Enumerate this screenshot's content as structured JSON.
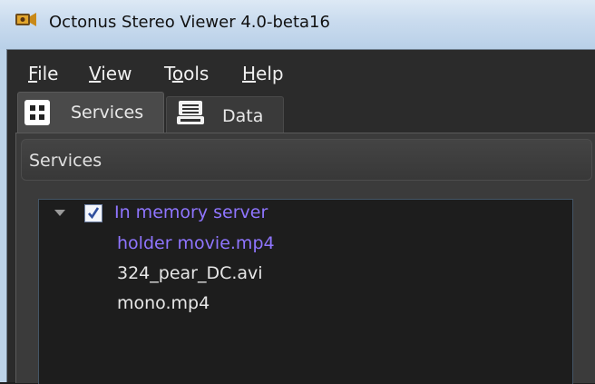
{
  "window": {
    "title": "Octonus Stereo Viewer 4.0-beta16"
  },
  "menu": {
    "items": [
      {
        "mnemonic": "F",
        "rest": "ile"
      },
      {
        "mnemonic": "V",
        "rest": "iew"
      },
      {
        "pre": "T",
        "mnemonic": "o",
        "rest": "ols"
      },
      {
        "mnemonic": "H",
        "rest": "elp"
      }
    ]
  },
  "tabs": [
    {
      "label": "Services",
      "icon": "services-grid-icon",
      "active": true
    },
    {
      "label": "Data",
      "icon": "data-stack-icon",
      "active": false
    }
  ],
  "panel": {
    "title": "Services"
  },
  "tree": {
    "server": {
      "label": "In memory server",
      "checked": true,
      "expanded": true
    },
    "files": [
      {
        "name": "holder movie.mp4",
        "selected": true
      },
      {
        "name": "324_pear_DC.avi",
        "selected": false
      },
      {
        "name": "mono.mp4",
        "selected": false
      }
    ]
  },
  "colors": {
    "selected_text": "#8f75ff",
    "background": "#1d1d1d",
    "panel": "#3b3b3b"
  }
}
